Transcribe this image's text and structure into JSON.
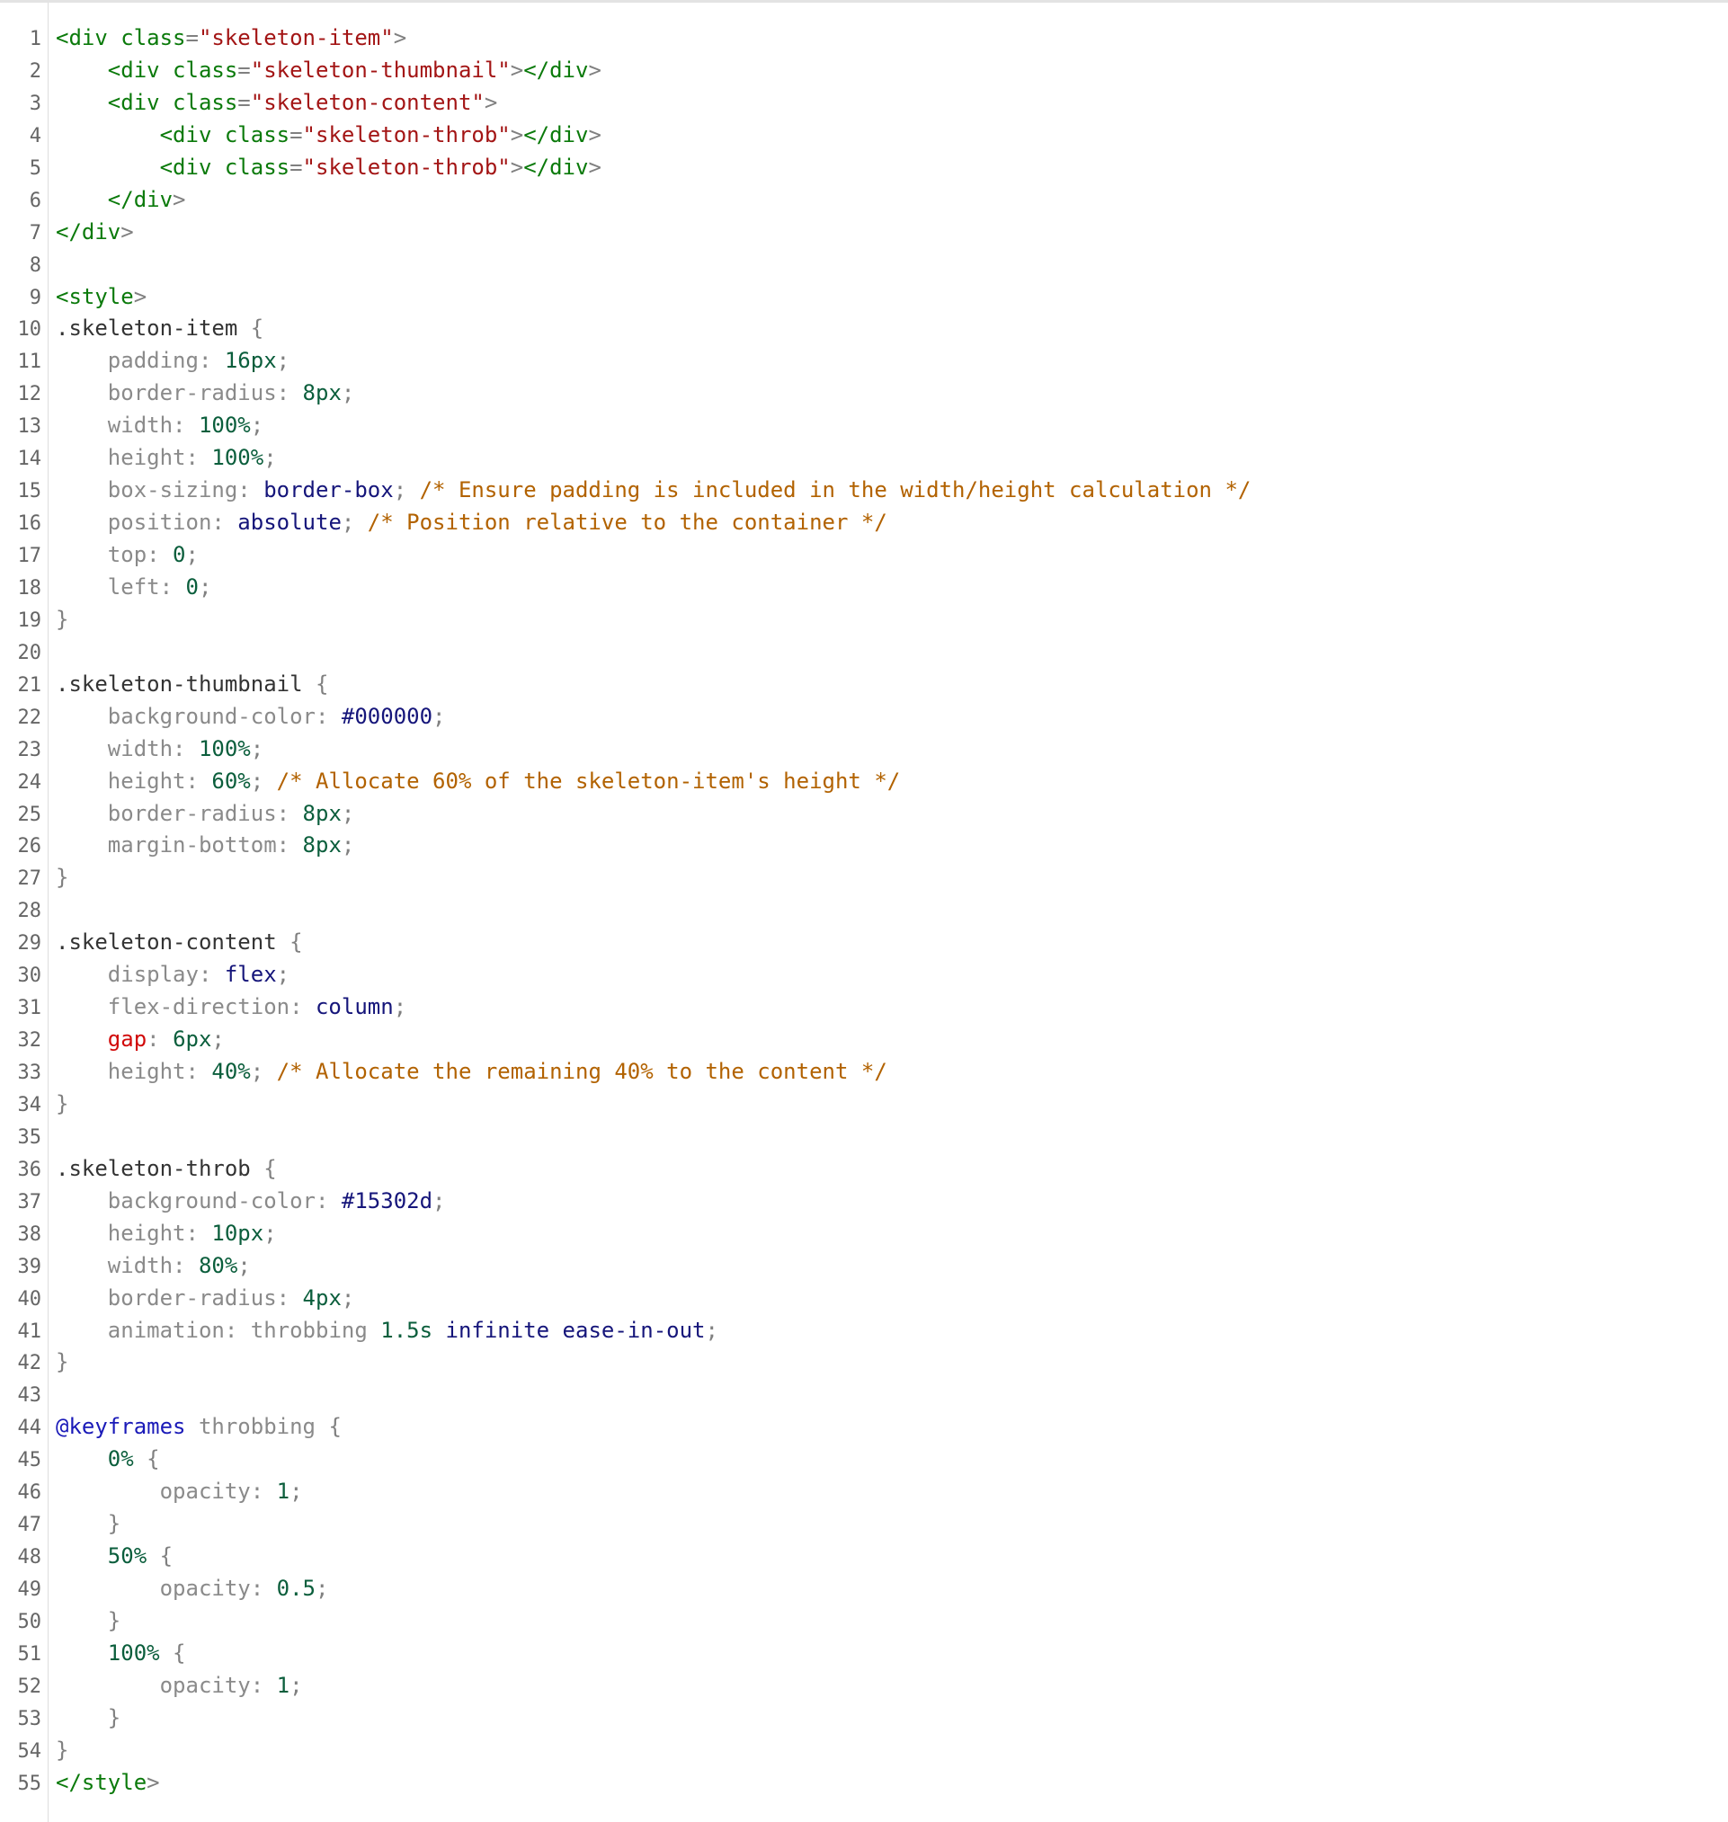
{
  "editor": {
    "line_numbers": [
      "1",
      "2",
      "3",
      "4",
      "5",
      "6",
      "7",
      "8",
      "9",
      "10",
      "11",
      "12",
      "13",
      "14",
      "15",
      "16",
      "17",
      "18",
      "19",
      "20",
      "21",
      "22",
      "23",
      "24",
      "25",
      "26",
      "27",
      "28",
      "29",
      "30",
      "31",
      "32",
      "33",
      "34",
      "35",
      "36",
      "37",
      "38",
      "39",
      "40",
      "41",
      "42",
      "43",
      "44",
      "45",
      "46",
      "47",
      "48",
      "49",
      "50",
      "51",
      "52",
      "53",
      "54",
      "55"
    ],
    "colors": {
      "tag": "#0b7a0b",
      "string": "#a31515",
      "property": "#8a8a8a",
      "property_highlight": "#d10a0a",
      "number": "#0b5e3c",
      "keyword": "#15157a",
      "comment": "#b26200",
      "at_rule": "#1a1ab8"
    },
    "lines": [
      [
        {
          "c": "t-tag",
          "t": "<div "
        },
        {
          "c": "t-attr",
          "t": "class"
        },
        {
          "c": "t-punct",
          "t": "="
        },
        {
          "c": "t-str",
          "t": "\"skeleton-item\""
        },
        {
          "c": "t-punct",
          "t": ">"
        }
      ],
      [
        {
          "c": "t-text",
          "t": "    "
        },
        {
          "c": "t-tag",
          "t": "<div "
        },
        {
          "c": "t-attr",
          "t": "class"
        },
        {
          "c": "t-punct",
          "t": "="
        },
        {
          "c": "t-str",
          "t": "\"skeleton-thumbnail\""
        },
        {
          "c": "t-punct",
          "t": ">"
        },
        {
          "c": "t-tag",
          "t": "</div"
        },
        {
          "c": "t-punct",
          "t": ">"
        }
      ],
      [
        {
          "c": "t-text",
          "t": "    "
        },
        {
          "c": "t-tag",
          "t": "<div "
        },
        {
          "c": "t-attr",
          "t": "class"
        },
        {
          "c": "t-punct",
          "t": "="
        },
        {
          "c": "t-str",
          "t": "\"skeleton-content\""
        },
        {
          "c": "t-punct",
          "t": ">"
        }
      ],
      [
        {
          "c": "t-text",
          "t": "        "
        },
        {
          "c": "t-tag",
          "t": "<div "
        },
        {
          "c": "t-attr",
          "t": "class"
        },
        {
          "c": "t-punct",
          "t": "="
        },
        {
          "c": "t-str",
          "t": "\"skeleton-throb\""
        },
        {
          "c": "t-punct",
          "t": ">"
        },
        {
          "c": "t-tag",
          "t": "</div"
        },
        {
          "c": "t-punct",
          "t": ">"
        }
      ],
      [
        {
          "c": "t-text",
          "t": "        "
        },
        {
          "c": "t-tag",
          "t": "<div "
        },
        {
          "c": "t-attr",
          "t": "class"
        },
        {
          "c": "t-punct",
          "t": "="
        },
        {
          "c": "t-str",
          "t": "\"skeleton-throb\""
        },
        {
          "c": "t-punct",
          "t": ">"
        },
        {
          "c": "t-tag",
          "t": "</div"
        },
        {
          "c": "t-punct",
          "t": ">"
        }
      ],
      [
        {
          "c": "t-text",
          "t": "    "
        },
        {
          "c": "t-tag",
          "t": "</div"
        },
        {
          "c": "t-punct",
          "t": ">"
        }
      ],
      [
        {
          "c": "t-tag",
          "t": "</div"
        },
        {
          "c": "t-punct",
          "t": ">"
        }
      ],
      [],
      [
        {
          "c": "t-tag",
          "t": "<style"
        },
        {
          "c": "t-punct",
          "t": ">"
        }
      ],
      [
        {
          "c": "t-sel",
          "t": ".skeleton-item "
        },
        {
          "c": "t-punct",
          "t": "{"
        }
      ],
      [
        {
          "c": "t-text",
          "t": "    "
        },
        {
          "c": "t-prop",
          "t": "padding: "
        },
        {
          "c": "t-num",
          "t": "16px"
        },
        {
          "c": "t-punct",
          "t": ";"
        }
      ],
      [
        {
          "c": "t-text",
          "t": "    "
        },
        {
          "c": "t-prop",
          "t": "border-radius: "
        },
        {
          "c": "t-num",
          "t": "8px"
        },
        {
          "c": "t-punct",
          "t": ";"
        }
      ],
      [
        {
          "c": "t-text",
          "t": "    "
        },
        {
          "c": "t-prop",
          "t": "width: "
        },
        {
          "c": "t-num",
          "t": "100%"
        },
        {
          "c": "t-punct",
          "t": ";"
        }
      ],
      [
        {
          "c": "t-text",
          "t": "    "
        },
        {
          "c": "t-prop",
          "t": "height: "
        },
        {
          "c": "t-num",
          "t": "100%"
        },
        {
          "c": "t-punct",
          "t": ";"
        }
      ],
      [
        {
          "c": "t-text",
          "t": "    "
        },
        {
          "c": "t-prop",
          "t": "box-sizing: "
        },
        {
          "c": "t-kw",
          "t": "border-box"
        },
        {
          "c": "t-punct",
          "t": "; "
        },
        {
          "c": "t-comment",
          "t": "/* Ensure padding is included in the width/height calculation */"
        }
      ],
      [
        {
          "c": "t-text",
          "t": "    "
        },
        {
          "c": "t-prop",
          "t": "position: "
        },
        {
          "c": "t-kw",
          "t": "absolute"
        },
        {
          "c": "t-punct",
          "t": "; "
        },
        {
          "c": "t-comment",
          "t": "/* Position relative to the container */"
        }
      ],
      [
        {
          "c": "t-text",
          "t": "    "
        },
        {
          "c": "t-prop",
          "t": "top: "
        },
        {
          "c": "t-num",
          "t": "0"
        },
        {
          "c": "t-punct",
          "t": ";"
        }
      ],
      [
        {
          "c": "t-text",
          "t": "    "
        },
        {
          "c": "t-prop",
          "t": "left: "
        },
        {
          "c": "t-num",
          "t": "0"
        },
        {
          "c": "t-punct",
          "t": ";"
        }
      ],
      [
        {
          "c": "t-punct",
          "t": "}"
        }
      ],
      [],
      [
        {
          "c": "t-sel",
          "t": ".skeleton-thumbnail "
        },
        {
          "c": "t-punct",
          "t": "{"
        }
      ],
      [
        {
          "c": "t-text",
          "t": "    "
        },
        {
          "c": "t-prop",
          "t": "background-color: "
        },
        {
          "c": "t-kw",
          "t": "#000000"
        },
        {
          "c": "t-punct",
          "t": ";"
        }
      ],
      [
        {
          "c": "t-text",
          "t": "    "
        },
        {
          "c": "t-prop",
          "t": "width: "
        },
        {
          "c": "t-num",
          "t": "100%"
        },
        {
          "c": "t-punct",
          "t": ";"
        }
      ],
      [
        {
          "c": "t-text",
          "t": "    "
        },
        {
          "c": "t-prop",
          "t": "height: "
        },
        {
          "c": "t-num",
          "t": "60%"
        },
        {
          "c": "t-punct",
          "t": "; "
        },
        {
          "c": "t-comment",
          "t": "/* Allocate 60% of the skeleton-item's height */"
        }
      ],
      [
        {
          "c": "t-text",
          "t": "    "
        },
        {
          "c": "t-prop",
          "t": "border-radius: "
        },
        {
          "c": "t-num",
          "t": "8px"
        },
        {
          "c": "t-punct",
          "t": ";"
        }
      ],
      [
        {
          "c": "t-text",
          "t": "    "
        },
        {
          "c": "t-prop",
          "t": "margin-bottom: "
        },
        {
          "c": "t-num",
          "t": "8px"
        },
        {
          "c": "t-punct",
          "t": ";"
        }
      ],
      [
        {
          "c": "t-punct",
          "t": "}"
        }
      ],
      [],
      [
        {
          "c": "t-sel",
          "t": ".skeleton-content "
        },
        {
          "c": "t-punct",
          "t": "{"
        }
      ],
      [
        {
          "c": "t-text",
          "t": "    "
        },
        {
          "c": "t-prop",
          "t": "display: "
        },
        {
          "c": "t-kw",
          "t": "flex"
        },
        {
          "c": "t-punct",
          "t": ";"
        }
      ],
      [
        {
          "c": "t-text",
          "t": "    "
        },
        {
          "c": "t-prop",
          "t": "flex-direction: "
        },
        {
          "c": "t-kw",
          "t": "column"
        },
        {
          "c": "t-punct",
          "t": ";"
        }
      ],
      [
        {
          "c": "t-text",
          "t": "    "
        },
        {
          "c": "t-prop-red",
          "t": "gap"
        },
        {
          "c": "t-prop",
          "t": ": "
        },
        {
          "c": "t-num",
          "t": "6px"
        },
        {
          "c": "t-punct",
          "t": ";"
        }
      ],
      [
        {
          "c": "t-text",
          "t": "    "
        },
        {
          "c": "t-prop",
          "t": "height: "
        },
        {
          "c": "t-num",
          "t": "40%"
        },
        {
          "c": "t-punct",
          "t": "; "
        },
        {
          "c": "t-comment",
          "t": "/* Allocate the remaining 40% to the content */"
        }
      ],
      [
        {
          "c": "t-punct",
          "t": "}"
        }
      ],
      [],
      [
        {
          "c": "t-sel",
          "t": ".skeleton-throb "
        },
        {
          "c": "t-punct",
          "t": "{"
        }
      ],
      [
        {
          "c": "t-text",
          "t": "    "
        },
        {
          "c": "t-prop",
          "t": "background-color: "
        },
        {
          "c": "t-kw",
          "t": "#15302d"
        },
        {
          "c": "t-punct",
          "t": ";"
        }
      ],
      [
        {
          "c": "t-text",
          "t": "    "
        },
        {
          "c": "t-prop",
          "t": "height: "
        },
        {
          "c": "t-num",
          "t": "10px"
        },
        {
          "c": "t-punct",
          "t": ";"
        }
      ],
      [
        {
          "c": "t-text",
          "t": "    "
        },
        {
          "c": "t-prop",
          "t": "width: "
        },
        {
          "c": "t-num",
          "t": "80%"
        },
        {
          "c": "t-punct",
          "t": ";"
        }
      ],
      [
        {
          "c": "t-text",
          "t": "    "
        },
        {
          "c": "t-prop",
          "t": "border-radius: "
        },
        {
          "c": "t-num",
          "t": "4px"
        },
        {
          "c": "t-punct",
          "t": ";"
        }
      ],
      [
        {
          "c": "t-text",
          "t": "    "
        },
        {
          "c": "t-prop",
          "t": "animation: "
        },
        {
          "c": "t-plain",
          "t": "throbbing "
        },
        {
          "c": "t-num",
          "t": "1.5s "
        },
        {
          "c": "t-kw",
          "t": "infinite ease-in-out"
        },
        {
          "c": "t-punct",
          "t": ";"
        }
      ],
      [
        {
          "c": "t-punct",
          "t": "}"
        }
      ],
      [],
      [
        {
          "c": "t-at",
          "t": "@keyframes "
        },
        {
          "c": "t-plain",
          "t": "throbbing "
        },
        {
          "c": "t-punct",
          "t": "{"
        }
      ],
      [
        {
          "c": "t-text",
          "t": "    "
        },
        {
          "c": "t-num",
          "t": "0% "
        },
        {
          "c": "t-punct",
          "t": "{"
        }
      ],
      [
        {
          "c": "t-text",
          "t": "        "
        },
        {
          "c": "t-prop",
          "t": "opacity: "
        },
        {
          "c": "t-num",
          "t": "1"
        },
        {
          "c": "t-punct",
          "t": ";"
        }
      ],
      [
        {
          "c": "t-text",
          "t": "    "
        },
        {
          "c": "t-punct",
          "t": "}"
        }
      ],
      [
        {
          "c": "t-text",
          "t": "    "
        },
        {
          "c": "t-num",
          "t": "50% "
        },
        {
          "c": "t-punct",
          "t": "{"
        }
      ],
      [
        {
          "c": "t-text",
          "t": "        "
        },
        {
          "c": "t-prop",
          "t": "opacity: "
        },
        {
          "c": "t-num",
          "t": "0.5"
        },
        {
          "c": "t-punct",
          "t": ";"
        }
      ],
      [
        {
          "c": "t-text",
          "t": "    "
        },
        {
          "c": "t-punct",
          "t": "}"
        }
      ],
      [
        {
          "c": "t-text",
          "t": "    "
        },
        {
          "c": "t-num",
          "t": "100% "
        },
        {
          "c": "t-punct",
          "t": "{"
        }
      ],
      [
        {
          "c": "t-text",
          "t": "        "
        },
        {
          "c": "t-prop",
          "t": "opacity: "
        },
        {
          "c": "t-num",
          "t": "1"
        },
        {
          "c": "t-punct",
          "t": ";"
        }
      ],
      [
        {
          "c": "t-text",
          "t": "    "
        },
        {
          "c": "t-punct",
          "t": "}"
        }
      ],
      [
        {
          "c": "t-punct",
          "t": "}"
        }
      ],
      [
        {
          "c": "t-tag",
          "t": "</style"
        },
        {
          "c": "t-punct",
          "t": ">"
        }
      ]
    ]
  }
}
